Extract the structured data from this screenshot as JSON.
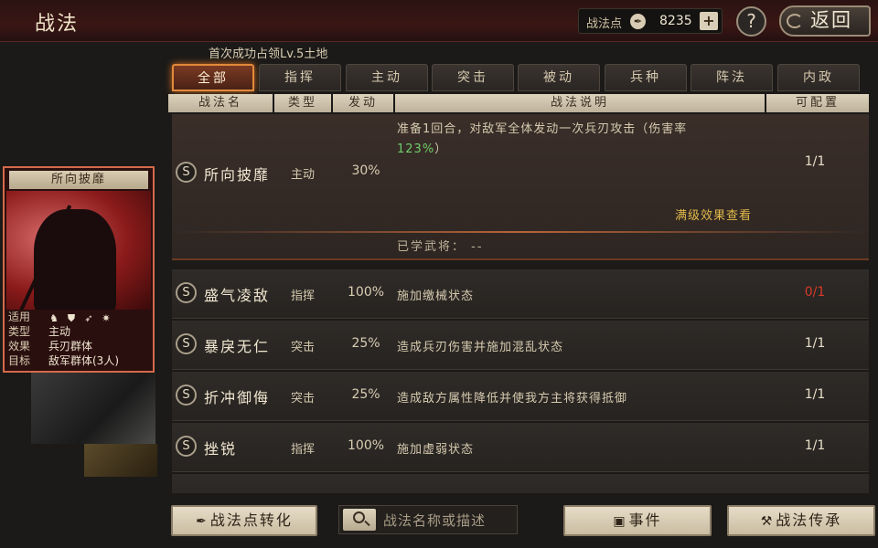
{
  "header": {
    "title": "战法",
    "points_label": "战法点",
    "points_value": "8235",
    "plus_label": "+",
    "help_label": "?",
    "back_label": "返回"
  },
  "subtitle": "首次成功占领Lv.5土地",
  "tabs": [
    {
      "label": "全部",
      "active": true
    },
    {
      "label": "指挥"
    },
    {
      "label": "主动"
    },
    {
      "label": "突击"
    },
    {
      "label": "被动"
    },
    {
      "label": "兵种"
    },
    {
      "label": "阵法"
    },
    {
      "label": "内政"
    }
  ],
  "columns": {
    "name": "战法名",
    "type": "类型",
    "rate": "发动",
    "desc": "战法说明",
    "config": "可配置"
  },
  "skills": [
    {
      "badge": "S",
      "name": "所向披靡",
      "type": "主动",
      "rate": "30%",
      "desc_part1": "准备1回合，对敌军全体发动一次兵刃攻击（伤害率",
      "desc_highlight": "123%",
      "desc_part2": "）",
      "config": "1/1",
      "full_level_link": "满级效果查看",
      "learned": "已学武将：  --"
    },
    {
      "badge": "S",
      "name": "盛气凌敌",
      "type": "指挥",
      "rate": "100%",
      "desc": "施加缴械状态",
      "config": "0/1"
    },
    {
      "badge": "S",
      "name": "暴戾无仁",
      "type": "突击",
      "rate": "25%",
      "desc": "造成兵刃伤害并施加混乱状态",
      "config": "1/1"
    },
    {
      "badge": "S",
      "name": "折冲御侮",
      "type": "突击",
      "rate": "25%",
      "desc": "造成敌方属性降低并使我方主将获得抵御",
      "config": "1/1"
    },
    {
      "badge": "S",
      "name": "挫锐",
      "type": "指挥",
      "rate": "100%",
      "desc": "施加虚弱状态",
      "config": "1/1"
    }
  ],
  "card": {
    "title": "所向披靡",
    "apply_label": "适用",
    "type_label": "类型",
    "type_value": "主动",
    "effect_label": "效果",
    "effect_value": "兵刃群体",
    "target_label": "目标",
    "target_value": "敌军群体(3人)",
    "apply_icons": [
      "horse-icon",
      "shield-icon",
      "bow-icon",
      "wheel-icon"
    ]
  },
  "bottom": {
    "convert_label": "战法点转化",
    "search_placeholder": "战法名称或描述",
    "events_label": "事件",
    "inherit_label": "战法传承"
  }
}
